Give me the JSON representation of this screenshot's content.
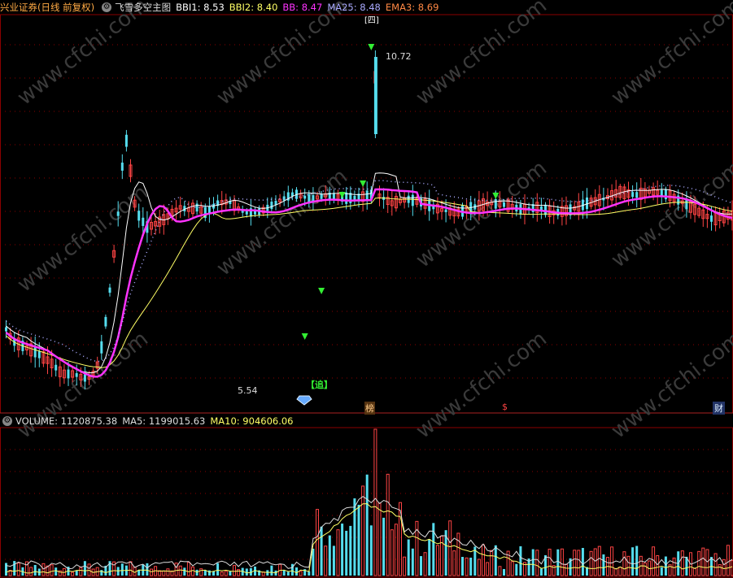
{
  "main_legend": {
    "stock": "兴业证券",
    "period": "(日线 前复权)",
    "indicator": "飞雪多空主图",
    "items": [
      {
        "label": "BBI1: 8.53",
        "color": "#ffffff"
      },
      {
        "label": "BBI2: 8.40",
        "color": "#ffff66"
      },
      {
        "label": "BB: 8.47",
        "color": "#ff33ff"
      },
      {
        "label": "MA25: 8.48",
        "color": "#aaaaff"
      },
      {
        "label": "EMA3: 8.69",
        "color": "#ff8844"
      }
    ]
  },
  "volume_legend": {
    "items": [
      {
        "label": "VOLUME: 1120875.38",
        "color": "#dddddd"
      },
      {
        "label": "MA5: 1199015.63",
        "color": "#dddddd"
      },
      {
        "label": "MA10: 904606.06",
        "color": "#ffff66"
      }
    ]
  },
  "annotations": {
    "high_price": "10.72",
    "low_price": "5.54",
    "chase_label": "【追】",
    "top_tag": "[四]",
    "bottom_tags": [
      "榜",
      "$",
      "财"
    ]
  },
  "watermark": "www.cfchi.com",
  "colors": {
    "up": "#ff4444",
    "down": "#55ddee",
    "bbi1": "#ffffff",
    "bbi2": "#ffff66",
    "bb": "#ff33ff",
    "ma25": "#aaaaff",
    "signal": "#33ee33",
    "grid": "#8b0000"
  }
}
